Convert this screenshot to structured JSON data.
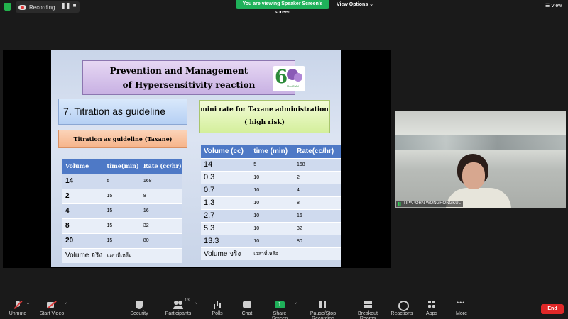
{
  "topbar": {
    "recording_label": "Recording...",
    "pause_symbol": "❚❚",
    "stop_symbol": "■",
    "banner_text": "You are viewing Speaker Screen's screen",
    "view_options_label": "View Options",
    "view_options_caret": "⌄",
    "view_label": "View",
    "view_icon": "☰"
  },
  "slide": {
    "title_line1": "Prevention and Management",
    "title_line2": "of Hypersensitivity reaction",
    "logo_number": "6",
    "logo_mark": "MedCMU",
    "heading": "7. Titration as guideline",
    "subheading": "Titration as guideline (Taxane)",
    "green_line1": "mini rate for Taxane administration",
    "green_line2": "( high risk)",
    "table1": {
      "headers": [
        "Volume",
        "time(min)",
        "Rate (cc/hr)"
      ],
      "rows": [
        [
          "14",
          "5",
          "168"
        ],
        [
          "2",
          "15",
          "8"
        ],
        [
          "4",
          "15",
          "16"
        ],
        [
          "8",
          "15",
          "32"
        ],
        [
          "20",
          "15",
          "80"
        ]
      ],
      "last_row": [
        "Volume จริง",
        "เวลาที่เหลือ",
        ""
      ]
    },
    "table2": {
      "headers": [
        "Volume (cc)",
        "time (min)",
        "Rate(cc/hr)"
      ],
      "rows": [
        [
          "14",
          "5",
          "168"
        ],
        [
          "0.3",
          "10",
          "2"
        ],
        [
          "0.7",
          "10",
          "4"
        ],
        [
          "1.3",
          "10",
          "8"
        ],
        [
          "2.7",
          "10",
          "16"
        ],
        [
          "5.3",
          "10",
          "32"
        ],
        [
          "13.3",
          "10",
          "80"
        ]
      ],
      "last_row": [
        "Volume จริง",
        "เวลาที่เหลือ",
        ""
      ]
    }
  },
  "video": {
    "participant_name": "TIPAPORN WONGHONGKUL"
  },
  "toolbar": {
    "unmute_label": "Unmute",
    "start_video_label": "Start Video",
    "security_label": "Security",
    "participants_label": "Participants",
    "participants_count": "13",
    "polls_label": "Polls",
    "chat_label": "Chat",
    "share_screen_label": "Share Screen",
    "pause_stop_label": "Pause/Stop Recording",
    "breakout_label": "Breakout Rooms",
    "reactions_label": "Reactions",
    "apps_label": "Apps",
    "more_label": "More",
    "end_label": "End",
    "caret": "^"
  },
  "colors": {
    "banner_green": "#1fb15a",
    "end_red": "#e02828",
    "table_header_blue": "#4e79c6",
    "title_box_purple": "#c8b1e3",
    "orange_box": "#f6b48a",
    "green_box": "#d4ef9c"
  }
}
